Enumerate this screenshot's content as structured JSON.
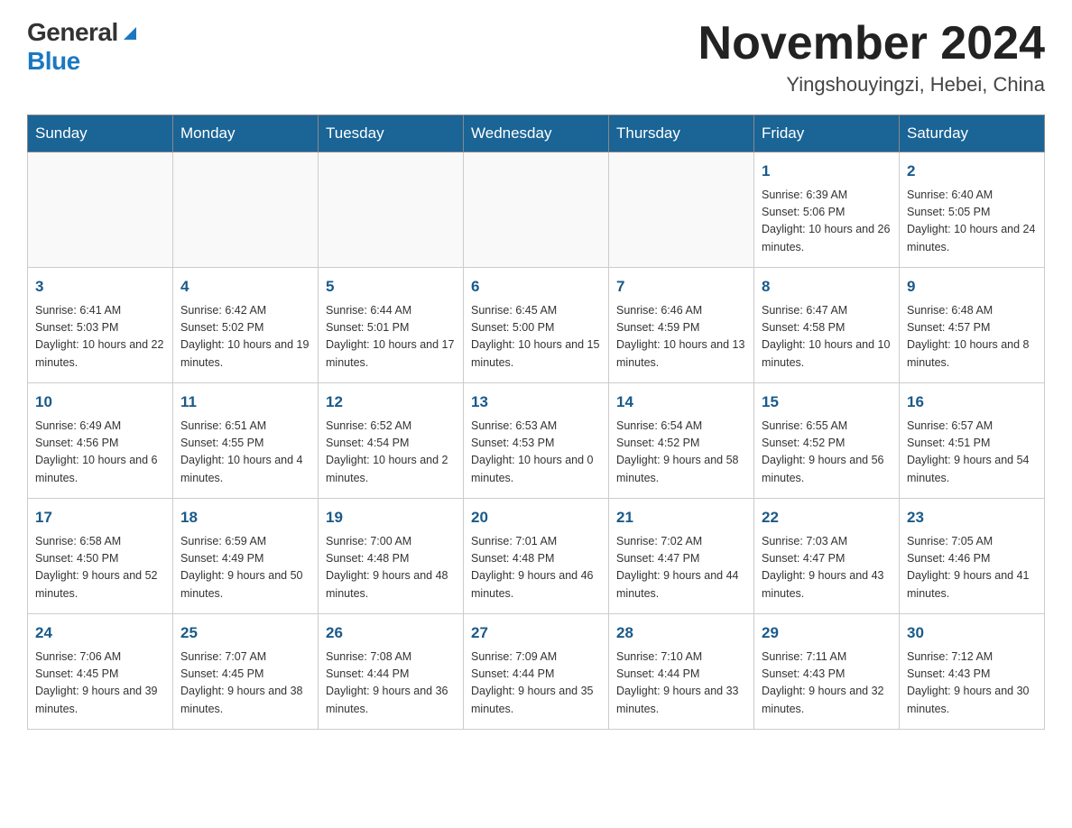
{
  "header": {
    "logo": {
      "general": "General",
      "blue": "Blue",
      "triangle": "▶"
    },
    "month_title": "November 2024",
    "location": "Yingshouyingzi, Hebei, China"
  },
  "weekdays": [
    "Sunday",
    "Monday",
    "Tuesday",
    "Wednesday",
    "Thursday",
    "Friday",
    "Saturday"
  ],
  "weeks": [
    [
      {
        "day": "",
        "info": ""
      },
      {
        "day": "",
        "info": ""
      },
      {
        "day": "",
        "info": ""
      },
      {
        "day": "",
        "info": ""
      },
      {
        "day": "",
        "info": ""
      },
      {
        "day": "1",
        "info": "Sunrise: 6:39 AM\nSunset: 5:06 PM\nDaylight: 10 hours and 26 minutes."
      },
      {
        "day": "2",
        "info": "Sunrise: 6:40 AM\nSunset: 5:05 PM\nDaylight: 10 hours and 24 minutes."
      }
    ],
    [
      {
        "day": "3",
        "info": "Sunrise: 6:41 AM\nSunset: 5:03 PM\nDaylight: 10 hours and 22 minutes."
      },
      {
        "day": "4",
        "info": "Sunrise: 6:42 AM\nSunset: 5:02 PM\nDaylight: 10 hours and 19 minutes."
      },
      {
        "day": "5",
        "info": "Sunrise: 6:44 AM\nSunset: 5:01 PM\nDaylight: 10 hours and 17 minutes."
      },
      {
        "day": "6",
        "info": "Sunrise: 6:45 AM\nSunset: 5:00 PM\nDaylight: 10 hours and 15 minutes."
      },
      {
        "day": "7",
        "info": "Sunrise: 6:46 AM\nSunset: 4:59 PM\nDaylight: 10 hours and 13 minutes."
      },
      {
        "day": "8",
        "info": "Sunrise: 6:47 AM\nSunset: 4:58 PM\nDaylight: 10 hours and 10 minutes."
      },
      {
        "day": "9",
        "info": "Sunrise: 6:48 AM\nSunset: 4:57 PM\nDaylight: 10 hours and 8 minutes."
      }
    ],
    [
      {
        "day": "10",
        "info": "Sunrise: 6:49 AM\nSunset: 4:56 PM\nDaylight: 10 hours and 6 minutes."
      },
      {
        "day": "11",
        "info": "Sunrise: 6:51 AM\nSunset: 4:55 PM\nDaylight: 10 hours and 4 minutes."
      },
      {
        "day": "12",
        "info": "Sunrise: 6:52 AM\nSunset: 4:54 PM\nDaylight: 10 hours and 2 minutes."
      },
      {
        "day": "13",
        "info": "Sunrise: 6:53 AM\nSunset: 4:53 PM\nDaylight: 10 hours and 0 minutes."
      },
      {
        "day": "14",
        "info": "Sunrise: 6:54 AM\nSunset: 4:52 PM\nDaylight: 9 hours and 58 minutes."
      },
      {
        "day": "15",
        "info": "Sunrise: 6:55 AM\nSunset: 4:52 PM\nDaylight: 9 hours and 56 minutes."
      },
      {
        "day": "16",
        "info": "Sunrise: 6:57 AM\nSunset: 4:51 PM\nDaylight: 9 hours and 54 minutes."
      }
    ],
    [
      {
        "day": "17",
        "info": "Sunrise: 6:58 AM\nSunset: 4:50 PM\nDaylight: 9 hours and 52 minutes."
      },
      {
        "day": "18",
        "info": "Sunrise: 6:59 AM\nSunset: 4:49 PM\nDaylight: 9 hours and 50 minutes."
      },
      {
        "day": "19",
        "info": "Sunrise: 7:00 AM\nSunset: 4:48 PM\nDaylight: 9 hours and 48 minutes."
      },
      {
        "day": "20",
        "info": "Sunrise: 7:01 AM\nSunset: 4:48 PM\nDaylight: 9 hours and 46 minutes."
      },
      {
        "day": "21",
        "info": "Sunrise: 7:02 AM\nSunset: 4:47 PM\nDaylight: 9 hours and 44 minutes."
      },
      {
        "day": "22",
        "info": "Sunrise: 7:03 AM\nSunset: 4:47 PM\nDaylight: 9 hours and 43 minutes."
      },
      {
        "day": "23",
        "info": "Sunrise: 7:05 AM\nSunset: 4:46 PM\nDaylight: 9 hours and 41 minutes."
      }
    ],
    [
      {
        "day": "24",
        "info": "Sunrise: 7:06 AM\nSunset: 4:45 PM\nDaylight: 9 hours and 39 minutes."
      },
      {
        "day": "25",
        "info": "Sunrise: 7:07 AM\nSunset: 4:45 PM\nDaylight: 9 hours and 38 minutes."
      },
      {
        "day": "26",
        "info": "Sunrise: 7:08 AM\nSunset: 4:44 PM\nDaylight: 9 hours and 36 minutes."
      },
      {
        "day": "27",
        "info": "Sunrise: 7:09 AM\nSunset: 4:44 PM\nDaylight: 9 hours and 35 minutes."
      },
      {
        "day": "28",
        "info": "Sunrise: 7:10 AM\nSunset: 4:44 PM\nDaylight: 9 hours and 33 minutes."
      },
      {
        "day": "29",
        "info": "Sunrise: 7:11 AM\nSunset: 4:43 PM\nDaylight: 9 hours and 32 minutes."
      },
      {
        "day": "30",
        "info": "Sunrise: 7:12 AM\nSunset: 4:43 PM\nDaylight: 9 hours and 30 minutes."
      }
    ]
  ]
}
